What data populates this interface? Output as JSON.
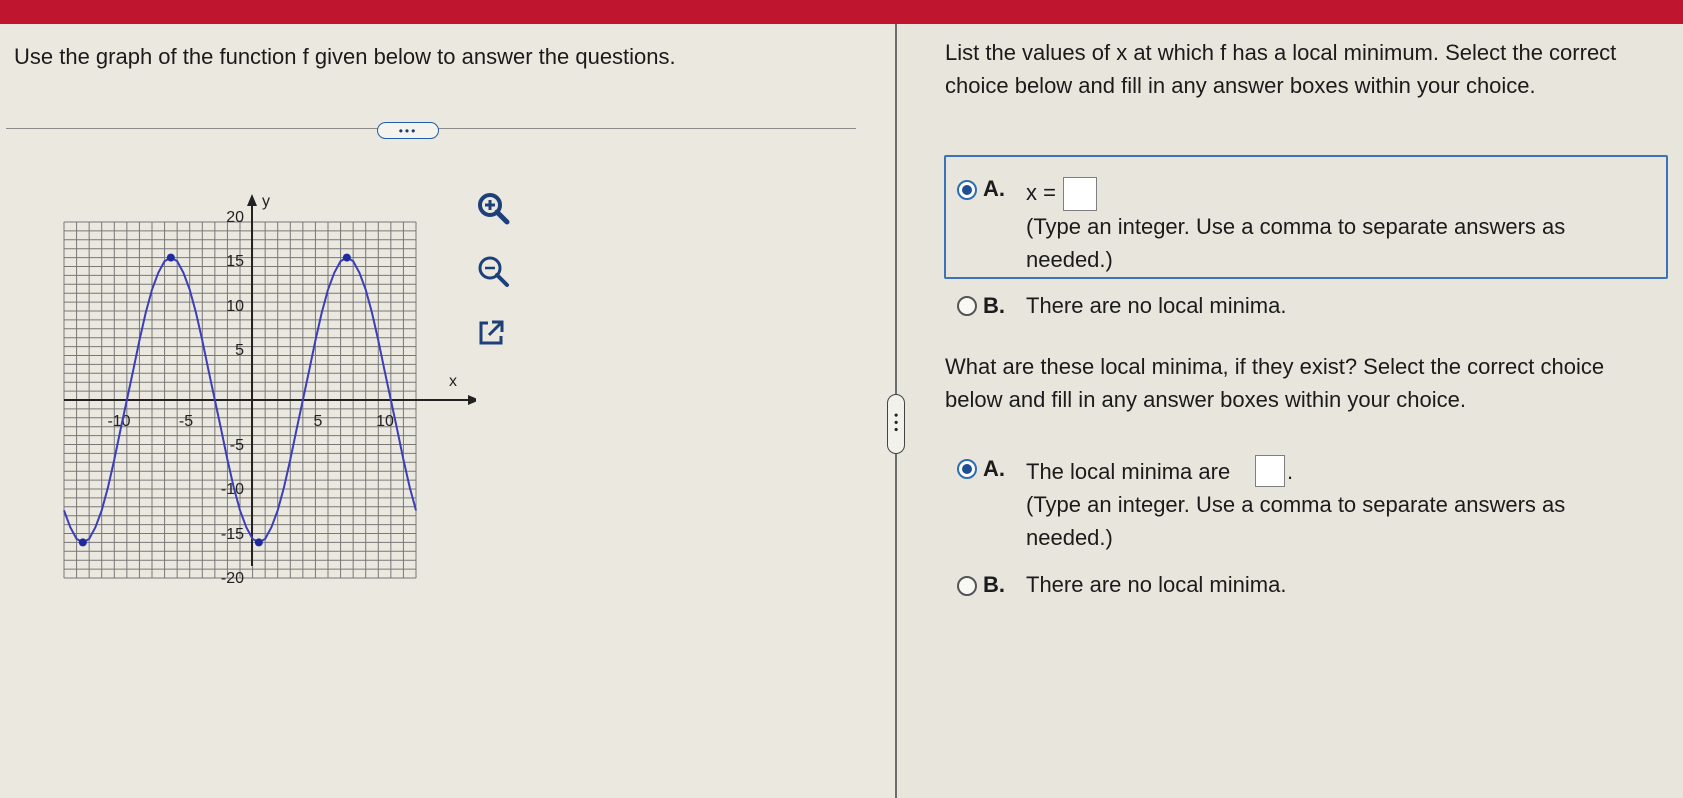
{
  "left": {
    "question": "Use the graph of the function f given below to answer the questions.",
    "more_label": "•••",
    "graph": {
      "y_axis_label": "y",
      "x_axis_label": "x",
      "y_ticks": [
        "20",
        "15",
        "10",
        "5",
        "-5",
        "-10",
        "-15",
        "-20"
      ],
      "x_ticks": [
        "-10",
        "-5",
        "5",
        "10"
      ]
    },
    "tools": [
      "zoom-in-icon",
      "zoom-out-icon",
      "open-new-window-icon"
    ]
  },
  "chart_data": {
    "type": "line",
    "xlabel": "x",
    "ylabel": "y",
    "xlim": [
      -14,
      14
    ],
    "ylim": [
      -20,
      20
    ],
    "grid": true,
    "series": [
      {
        "x": [
          -14,
          -13.5,
          -13,
          -12.5,
          -12,
          -11.5,
          -11,
          -10.5,
          -10,
          -9.5,
          -9,
          -8.5,
          -8,
          -7.5,
          -7,
          -6.5,
          -6,
          -5.5,
          -5,
          -4.5,
          -4,
          -3.5,
          -3,
          -2.5,
          -2,
          -1.5,
          -1,
          -0.5,
          0,
          0.5,
          1,
          1.5,
          2,
          2.5,
          3,
          3.5,
          4,
          4.5,
          5,
          5.5,
          6,
          6.5,
          7,
          7.5,
          8,
          8.5,
          9,
          9.5,
          10,
          10.5,
          11,
          11.5,
          12,
          12.5,
          13,
          13.5,
          14
        ],
        "y": [
          -12.4,
          -14.3,
          -15.6,
          -16.0,
          -15.6,
          -14.3,
          -12.4,
          -9.8,
          -6.7,
          -3.3,
          0.0,
          3.3,
          6.7,
          9.8,
          12.4,
          14.3,
          15.6,
          16.0,
          15.6,
          14.3,
          12.4,
          9.8,
          6.7,
          3.3,
          0.0,
          -3.3,
          -6.7,
          -9.8,
          -12.4,
          -14.3,
          -15.6,
          -16.0,
          -15.6,
          -14.3,
          -12.4,
          -9.8,
          -6.7,
          -3.3,
          0.0,
          3.3,
          6.7,
          9.8,
          12.4,
          14.3,
          15.6,
          16.0,
          15.6,
          14.3,
          12.4,
          9.8,
          6.7,
          3.3,
          0.0,
          -3.3,
          -6.7,
          -9.8,
          -12.4
        ]
      }
    ],
    "marked_points": [
      {
        "x": -12.5,
        "y": -16
      },
      {
        "x": -5.5,
        "y": 16
      },
      {
        "x": 1.5,
        "y": -16
      },
      {
        "x": 8.5,
        "y": 16
      }
    ],
    "line_color": "#3b3fb8",
    "point_color": "#1e2aa0"
  },
  "right": {
    "q1": {
      "prompt": "List the values of x at which f has a local minimum. Select the correct choice below and fill in any answer boxes within your choice.",
      "choice_a_letter": "A.",
      "choice_a_prefix": "x =",
      "choice_a_value": "",
      "choice_a_hint": "(Type an integer. Use a comma to separate answers as needed.)",
      "choice_b_letter": "B.",
      "choice_b_text": "There are no local minima."
    },
    "q2": {
      "prompt": "What are these local minima, if they exist? Select the correct choice below and fill in any answer boxes within your choice.",
      "choice_a_letter": "A.",
      "choice_a_prefix": "The local minima are",
      "choice_a_suffix": ".",
      "choice_a_value": "",
      "choice_a_hint": "(Type an integer. Use a comma to separate answers as needed.)",
      "choice_b_letter": "B.",
      "choice_b_text": "There are no local minima."
    }
  },
  "colors": {
    "header_red": "#c0152f",
    "selected_blue": "#2d6db5"
  }
}
